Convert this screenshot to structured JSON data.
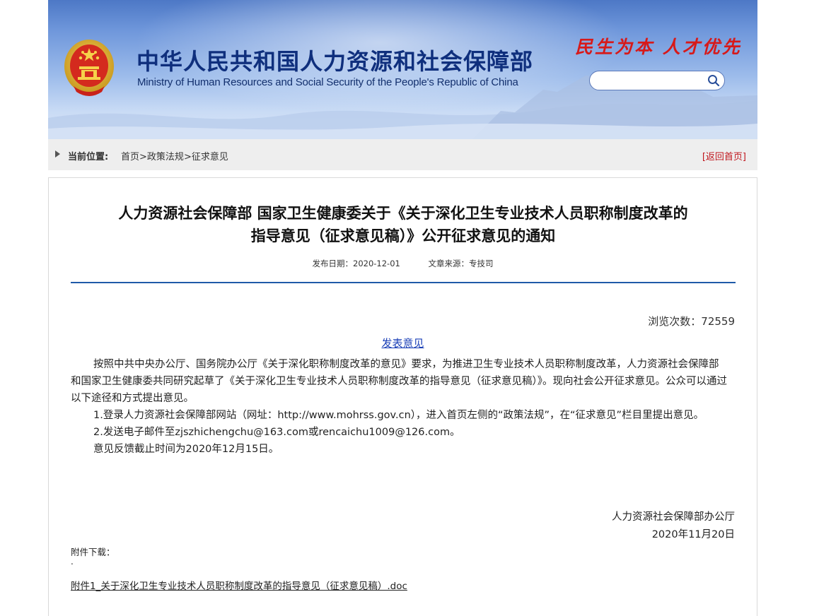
{
  "header": {
    "title_cn": "中华人民共和国人力资源和社会保障部",
    "title_en": "Ministry of Human Resources and Social Security of the People's Republic of China",
    "slogan": "民生为本 人才优先",
    "search_placeholder": "",
    "emblem_icon": "national-emblem-icon",
    "search_icon": "search-icon"
  },
  "breadcrumb": {
    "label": "当前位置:",
    "items": [
      "首页",
      "政策法规",
      "征求意见"
    ],
    "separator": ">",
    "back_home": "[返回首页]"
  },
  "article": {
    "title_line1": "人力资源社会保障部 国家卫生健康委关于《关于深化卫生专业技术人员职称制度改革的",
    "title_line2": "指导意见（征求意见稿）》公开征求意见的通知",
    "publish_date": "发布日期：2020-12-01",
    "source": "文章来源：专技司",
    "views": "浏览次数：72559",
    "comment_link": "发表意见",
    "paragraphs": [
      "按照中共中央办公厅、国务院办公厅《关于深化职称制度改革的意见》要求，为推进卫生专业技术人员职称制度改革，人力资源社会保障部和国家卫生健康委共同研究起草了《关于深化卫生专业技术人员职称制度改革的指导意见（征求意见稿）》。现向社会公开征求意见。公众可以通过以下途径和方式提出意见。",
      "1.登录人力资源社会保障部网站（网址：http://www.mohrss.gov.cn），进入首页左侧的“政策法规”，在“征求意见”栏目里提出意见。",
      "2.发送电子邮件至zjszhichengchu@163.com或rencaichu1009@126.com。",
      "意见反馈截止时间为2020年12月15日。"
    ],
    "signature_org": "人力资源社会保障部办公厅",
    "signature_date": "2020年11月20日",
    "attachment_label": "附件下载：",
    "attachment_dot": ".",
    "attachment_file": "附件1_关于深化卫生专业技术人员职称制度改革的指导意见（征求意见稿）.doc"
  },
  "colors": {
    "brand_blue": "#0f2f7d",
    "slogan_red": "#d71919",
    "link_blue": "#1a3fb7",
    "rule_blue": "#1f5aa8"
  }
}
